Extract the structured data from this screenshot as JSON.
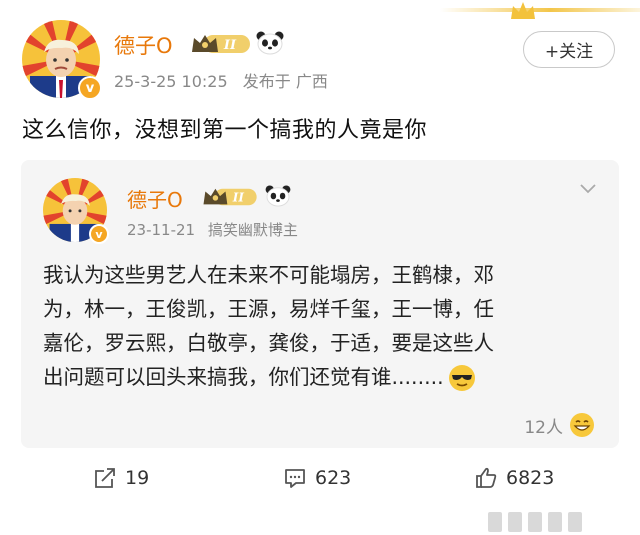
{
  "post": {
    "author_name": "德子O",
    "vip_level": "II",
    "date": "25-3-25 10:25",
    "source": "发布于 广西",
    "follow_label": "+关注",
    "text": "这么信你，没想到第一个搞我的人竟是你"
  },
  "quoted": {
    "author_name": "德子O",
    "vip_level": "II",
    "date": "23-11-21",
    "tag": "搞笑幽默博主",
    "lines": [
      "我认为这些男艺人在未来不可能塌房，王鹤棣，邓",
      "为，林一，王俊凯，王源，易烊千玺，王一博，任",
      "嘉伦，罗云熙，白敬亭，龚俊，于适，要是这些人",
      "出问题可以回头来搞我，你们还觉有谁........"
    ],
    "likes_text": "12人"
  },
  "actions": {
    "share_count": "19",
    "comment_count": "623",
    "like_count": "6823"
  },
  "colors": {
    "name_orange": "#e8780a",
    "verified_badge": "#f5a623",
    "quote_bg": "#f5f5f5"
  },
  "icons": [
    "crown-icon",
    "vip-badge-icon",
    "panda-icon",
    "verified-icon",
    "chevron-down-icon",
    "sunglasses-emoji-icon",
    "laugh-emoji-icon",
    "share-icon",
    "comment-icon",
    "like-icon"
  ]
}
